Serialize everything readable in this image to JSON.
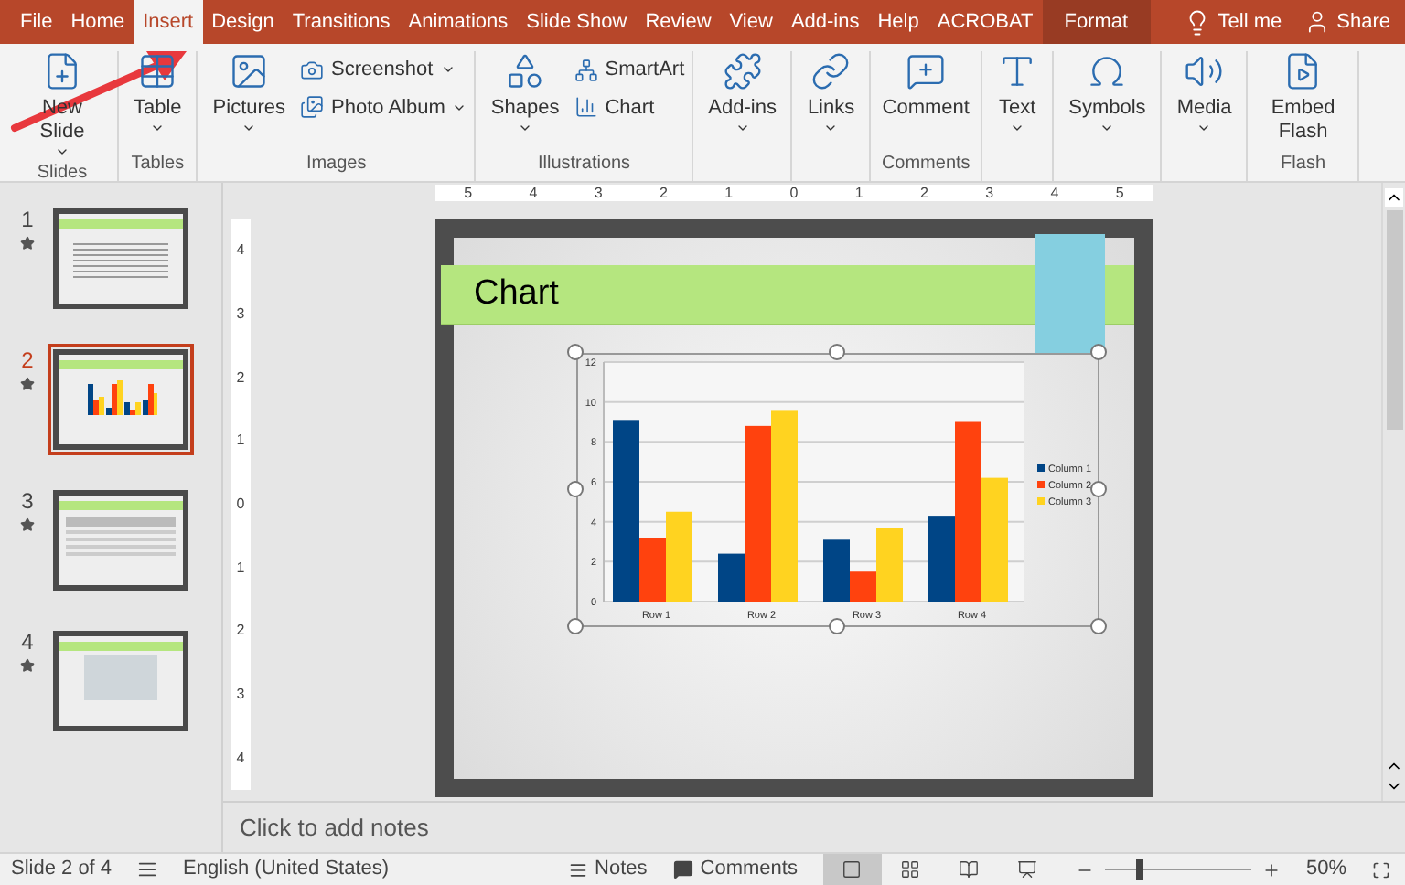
{
  "tabs": [
    {
      "label": "File",
      "selected": false,
      "contextual": false
    },
    {
      "label": "Home",
      "selected": false,
      "contextual": false
    },
    {
      "label": "Insert",
      "selected": true,
      "contextual": false
    },
    {
      "label": "Design",
      "selected": false,
      "contextual": false
    },
    {
      "label": "Transitions",
      "selected": false,
      "contextual": false
    },
    {
      "label": "Animations",
      "selected": false,
      "contextual": false
    },
    {
      "label": "Slide Show",
      "selected": false,
      "contextual": false
    },
    {
      "label": "Review",
      "selected": false,
      "contextual": false
    },
    {
      "label": "View",
      "selected": false,
      "contextual": false
    },
    {
      "label": "Add-ins",
      "selected": false,
      "contextual": false
    },
    {
      "label": "Help",
      "selected": false,
      "contextual": false
    },
    {
      "label": "ACROBAT",
      "selected": false,
      "contextual": false
    },
    {
      "label": "Format",
      "selected": false,
      "contextual": true
    }
  ],
  "tell_me": "Tell me",
  "share": "Share",
  "ribbon": [
    {
      "label": "Slides",
      "buttons": [
        {
          "kind": "large",
          "label": "New Slide",
          "dropdown": true
        }
      ]
    },
    {
      "label": "Tables",
      "buttons": [
        {
          "kind": "large",
          "label": "Table",
          "dropdown": true
        }
      ]
    },
    {
      "label": "Images",
      "buttons": [
        {
          "kind": "large",
          "label": "Pictures",
          "dropdown": true
        },
        {
          "kind": "small",
          "label": "Screenshot",
          "dropdown": true
        },
        {
          "kind": "small",
          "label": "Photo Album",
          "dropdown": true
        }
      ]
    },
    {
      "label": "Illustrations",
      "buttons": [
        {
          "kind": "large",
          "label": "Shapes",
          "dropdown": true
        },
        {
          "kind": "small",
          "label": "SmartArt",
          "dropdown": false
        },
        {
          "kind": "small",
          "label": "Chart",
          "dropdown": false
        }
      ]
    },
    {
      "buttons": [
        {
          "kind": "large",
          "label": "Add-ins",
          "dropdown": true
        }
      ]
    },
    {
      "buttons": [
        {
          "kind": "large",
          "label": "Links",
          "dropdown": true
        }
      ]
    },
    {
      "label": "Comments",
      "buttons": [
        {
          "kind": "large",
          "label": "Comment",
          "dropdown": false
        }
      ]
    },
    {
      "buttons": [
        {
          "kind": "large",
          "label": "Text",
          "dropdown": true
        }
      ]
    },
    {
      "buttons": [
        {
          "kind": "large",
          "label": "Symbols",
          "dropdown": true
        }
      ]
    },
    {
      "buttons": [
        {
          "kind": "large",
          "label": "Media",
          "dropdown": true
        }
      ]
    },
    {
      "label": "Flash",
      "buttons": [
        {
          "kind": "large",
          "label": "Embed Flash",
          "dropdown": false
        }
      ]
    }
  ],
  "slides": [
    {
      "number": "1",
      "selected": false,
      "kind": "text"
    },
    {
      "number": "2",
      "selected": true,
      "kind": "chart"
    },
    {
      "number": "3",
      "selected": false,
      "kind": "table"
    },
    {
      "number": "4",
      "selected": false,
      "kind": "photo"
    }
  ],
  "ruler_horizontal": [
    "5",
    "4",
    "3",
    "2",
    "1",
    "0",
    "1",
    "2",
    "3",
    "4",
    "5"
  ],
  "ruler_vertical": [
    "4",
    "3",
    "2",
    "1",
    "0",
    "1",
    "2",
    "3",
    "4"
  ],
  "slide": {
    "title": "Chart",
    "chart_data": {
      "type": "bar",
      "categories": [
        "Row 1",
        "Row 2",
        "Row 3",
        "Row 4"
      ],
      "series": [
        {
          "name": "Column 1",
          "color": "#004586",
          "values": [
            9.1,
            2.4,
            3.1,
            4.3
          ]
        },
        {
          "name": "Column 2",
          "color": "#ff420e",
          "values": [
            3.2,
            8.8,
            1.5,
            9.0
          ]
        },
        {
          "name": "Column 3",
          "color": "#ffd320",
          "values": [
            4.5,
            9.6,
            3.7,
            6.2
          ]
        }
      ],
      "ylim": [
        0,
        12
      ],
      "yticks": [
        0,
        2,
        4,
        6,
        8,
        10,
        12
      ],
      "grid": true,
      "legend": "right"
    }
  },
  "notes": {
    "placeholder": "Click to add notes"
  },
  "status_bar": {
    "slide": "Slide 2 of 4",
    "language": "English (United States)",
    "notes": "Notes",
    "comments": "Comments",
    "views": [
      {
        "selected": true
      },
      {
        "selected": false
      },
      {
        "selected": false
      },
      {
        "selected": false
      }
    ],
    "zoom": {
      "level": 0.24,
      "reading": "50%"
    }
  }
}
